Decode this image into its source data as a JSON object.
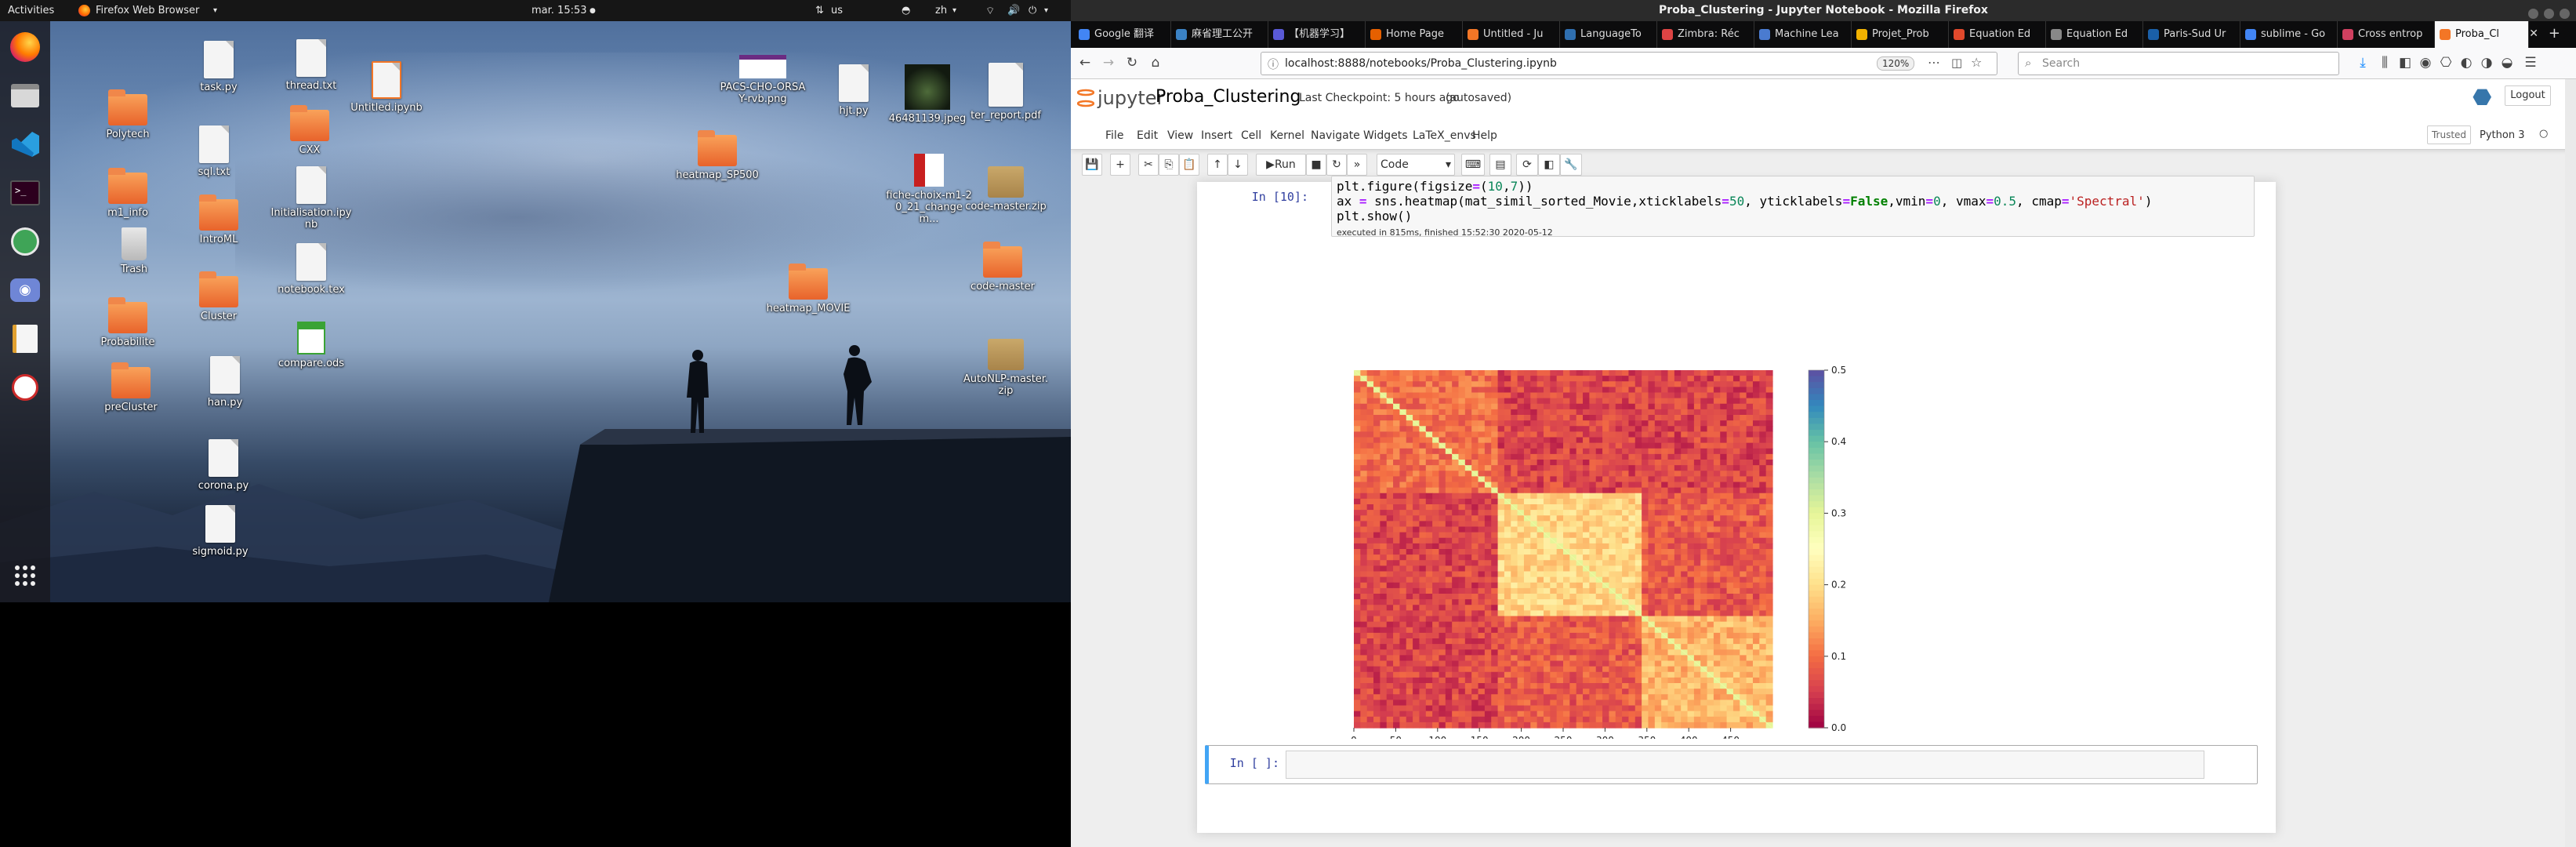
{
  "top_panel": {
    "activities": "Activities",
    "app_menu": "Firefox Web Browser",
    "clock": "mar. 15:53",
    "keyboard1": "us",
    "keyboard2": "zh"
  },
  "desktop": {
    "icons": [
      {
        "label": "Polytech",
        "kind": "folder"
      },
      {
        "label": "m1_info",
        "kind": "folder"
      },
      {
        "label": "Trash",
        "kind": "trash"
      },
      {
        "label": "Probabilite",
        "kind": "folder"
      },
      {
        "label": "preCluster",
        "kind": "folder"
      },
      {
        "label": "task.py",
        "kind": "file"
      },
      {
        "label": "sql.txt",
        "kind": "file"
      },
      {
        "label": "IntroML",
        "kind": "folder"
      },
      {
        "label": "Cluster",
        "kind": "folder"
      },
      {
        "label": "han.py",
        "kind": "file"
      },
      {
        "label": "corona.py",
        "kind": "py"
      },
      {
        "label": "sigmoid.py",
        "kind": "file"
      },
      {
        "label": "thread.txt",
        "kind": "file"
      },
      {
        "label": "CXX",
        "kind": "folder"
      },
      {
        "label": "Initialisation.ipynb",
        "kind": "file"
      },
      {
        "label": "notebook.tex",
        "kind": "file"
      },
      {
        "label": "compare.ods",
        "kind": "ods"
      },
      {
        "label": "Untitled.ipynb",
        "kind": "file"
      },
      {
        "label": "heatmap_SP500",
        "kind": "folder"
      },
      {
        "label": "PACS-CHO-ORSAY-rvb.png",
        "kind": "image"
      },
      {
        "label": "heatmap_MOVIE",
        "kind": "folder"
      },
      {
        "label": "hjt.py",
        "kind": "file"
      },
      {
        "label": "46481139.jpeg",
        "kind": "image"
      },
      {
        "label": "fiche-choix-m1-20_21_changem...",
        "kind": "pdf"
      },
      {
        "label": "ter_report.pdf",
        "kind": "file"
      },
      {
        "label": "code-master.zip",
        "kind": "zip"
      },
      {
        "label": "code-master",
        "kind": "folder"
      },
      {
        "label": "AutoNLP-master.zip",
        "kind": "zip"
      }
    ]
  },
  "browser": {
    "window_title": "Proba_Clustering - Jupyter Notebook - Mozilla Firefox",
    "tabs": [
      {
        "label": "Google 翻译",
        "color": "#4285f4"
      },
      {
        "label": "麻省理工公开",
        "color": "#3b82c4"
      },
      {
        "label": "【机器学习】",
        "color": "#5a5ad6"
      },
      {
        "label": "Home Page",
        "color": "#e66000"
      },
      {
        "label": "Untitled - Ju",
        "color": "#f37626"
      },
      {
        "label": "LanguageTo",
        "color": "#2f6fb0"
      },
      {
        "label": "Zimbra: Réc",
        "color": "#d44"
      },
      {
        "label": "Machine Lea",
        "color": "#4a7bd0"
      },
      {
        "label": "Projet_Prob",
        "color": "#f2b200"
      },
      {
        "label": "Equation Ed",
        "color": "#e0492c"
      },
      {
        "label": "Equation Ed",
        "color": "#888"
      },
      {
        "label": "Paris-Sud Ur",
        "color": "#1a5fa8"
      },
      {
        "label": "sublime - Go",
        "color": "#4285f4"
      },
      {
        "label": "Cross entrop",
        "color": "#d04060"
      },
      {
        "label": "Proba_Cl",
        "color": "#f37626"
      }
    ],
    "url": "localhost:8888/notebooks/Proba_Clustering.ipynb",
    "zoom": "120%",
    "search_placeholder": "Search"
  },
  "jupyter": {
    "logo_text": "jupyter",
    "notebook_name": "Proba_Clustering",
    "checkpoint": "Last Checkpoint: 5 hours ago",
    "autosaved": "(autosaved)",
    "logout": "Logout",
    "menu": [
      "File",
      "Edit",
      "View",
      "Insert",
      "Cell",
      "Kernel",
      "Navigate",
      "Widgets",
      "LaTeX_envs",
      "Help"
    ],
    "trusted": "Trusted",
    "kernel": "Python 3",
    "run_label": "Run",
    "cell_type": "Code",
    "cell1": {
      "prompt": "In [10]:",
      "line1": "plt.figure(figsize=(10,7))",
      "line2": "ax = sns.heatmap(mat_simil_sorted_Movie,xticklabels=50, yticklabels=False,vmin=0, vmax=0.5, cmap='Spectral')",
      "line3": "plt.show()",
      "exec_info": "executed in 815ms, finished 15:52:30 2020-05-12"
    },
    "cell2": {
      "prompt": "In [ ]:"
    }
  },
  "chart_data": {
    "type": "heatmap",
    "cmap": "Spectral",
    "vmin": 0,
    "vmax": 0.5,
    "x_ticks": [
      0,
      50,
      100,
      150,
      200,
      250,
      300,
      350,
      400,
      450
    ],
    "colorbar_ticks": [
      0.0,
      0.1,
      0.2,
      0.3,
      0.4,
      0.5
    ],
    "colorbar_labels": [
      "0.0",
      "0.1",
      "0.2",
      "0.3",
      "0.4",
      "0.5"
    ],
    "n": 500,
    "block_boundaries": [
      175,
      340
    ],
    "block_mean_similarity": [
      [
        0.1,
        0.06,
        0.06
      ],
      [
        0.06,
        0.19,
        0.08
      ],
      [
        0.06,
        0.08,
        0.16
      ]
    ],
    "diagonal": 0.5,
    "grid": false
  }
}
